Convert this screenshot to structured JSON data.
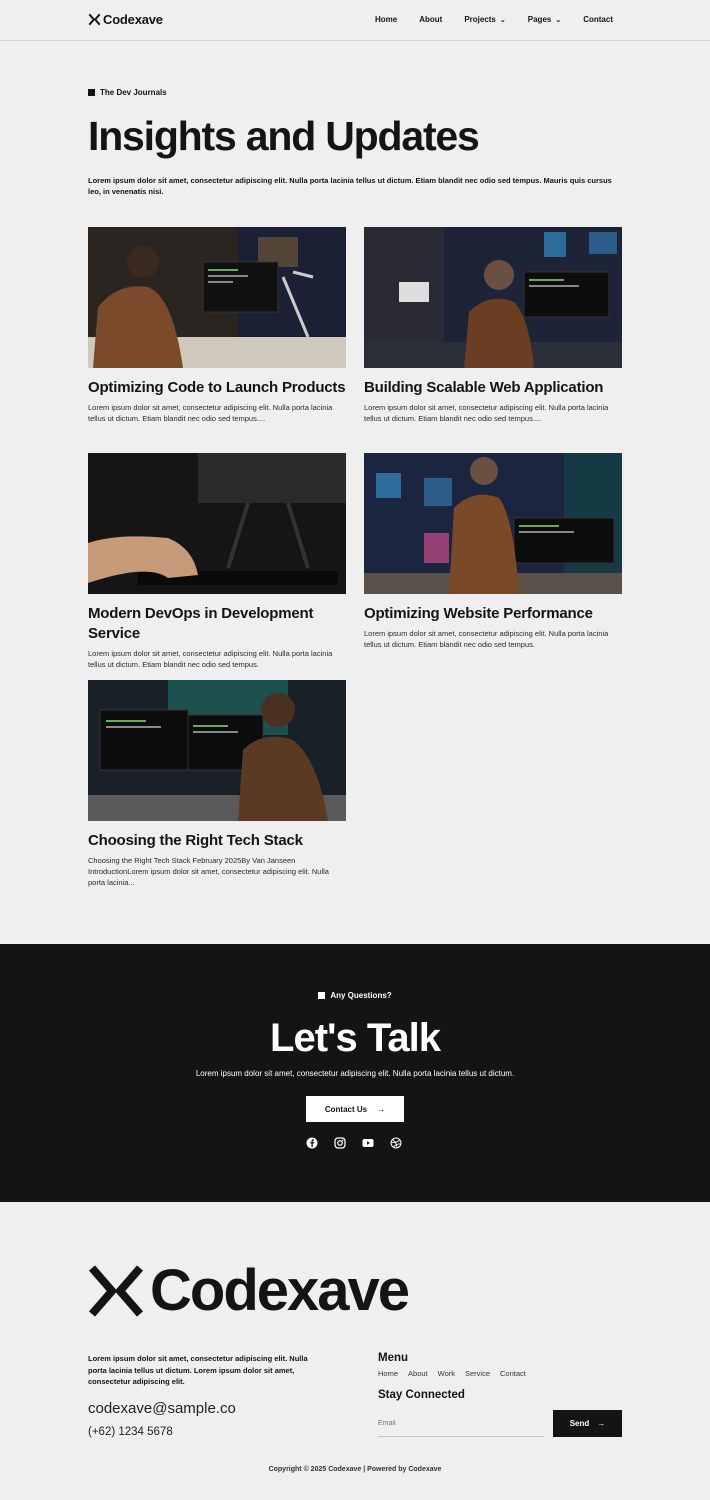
{
  "header": {
    "brand": "Codexave",
    "nav": [
      {
        "label": "Home",
        "dropdown": false
      },
      {
        "label": "About",
        "dropdown": false
      },
      {
        "label": "Projects",
        "dropdown": true
      },
      {
        "label": "Pages",
        "dropdown": true
      },
      {
        "label": "Contact",
        "dropdown": false
      }
    ]
  },
  "hero": {
    "eyebrow": "The Dev Journals",
    "title": "Insights and Updates",
    "description": "Lorem ipsum dolor sit amet, consectetur adipiscing elit. Nulla porta lacinia tellus ut dictum. Etiam blandit nec odio sed tempus. Mauris quis cursus leo, in venenatis nisi."
  },
  "posts": [
    {
      "title": "Optimizing Code to Launch Products",
      "excerpt": "Lorem ipsum dolor sit amet, consectetur adipiscing elit. Nulla porta lacinia tellus ut dictum. Etiam blandit nec odio sed tempus...."
    },
    {
      "title": "Building Scalable Web Application",
      "excerpt": "Lorem ipsum dolor sit amet, consectetur adipiscing elit. Nulla porta lacinia tellus ut dictum. Etiam blandit nec odio sed tempus...."
    },
    {
      "title": "Modern DevOps in Development Service",
      "excerpt": "Lorem ipsum dolor sit amet, consectetur adipiscing elit. Nulla porta lacinia tellus ut dictum. Etiam blandit nec odio sed tempus."
    },
    {
      "title": "Optimizing Website Performance",
      "excerpt": "Lorem ipsum dolor sit amet, consectetur adipiscing elit. Nulla porta lacinia tellus ut dictum. Etiam blandit nec odio sed tempus."
    },
    {
      "title": "Choosing the Right Tech Stack",
      "excerpt": "Choosing the Right Tech Stack February 2025By Van Janseen IntroductionLorem ipsum dolor sit amet, consectetur adipiscing elit. Nulla porta lacinia..."
    }
  ],
  "talk": {
    "eyebrow": "Any Questions?",
    "title": "Let's Talk",
    "description": "Lorem ipsum dolor sit amet, consectetur adipiscing elit. Nulla porta lacinia tellus ut dictum.",
    "button": "Contact Us",
    "socials": [
      "facebook-icon",
      "instagram-icon",
      "youtube-icon",
      "dribbble-icon"
    ]
  },
  "footer": {
    "brand": "Codexave",
    "description": "Lorem ipsum dolor sit amet, consectetur adipiscing elit. Nulla porta lacinia tellus ut dictum. Lorem ipsum dolor sit amet, consectetur adipiscing elit.",
    "email": "codexave@sample.co",
    "phone": "(+62) 1234 5678",
    "menu_title": "Menu",
    "menu": [
      "Home",
      "About",
      "Work",
      "Service",
      "Contact"
    ],
    "stay_title": "Stay Connected",
    "email_placeholder": "Email",
    "send_label": "Send",
    "copyright": "Copyright © 2025 Codexave | Powered by Codexave"
  },
  "colors": {
    "dark": "#141414",
    "background": "#efefef",
    "white": "#ffffff"
  }
}
